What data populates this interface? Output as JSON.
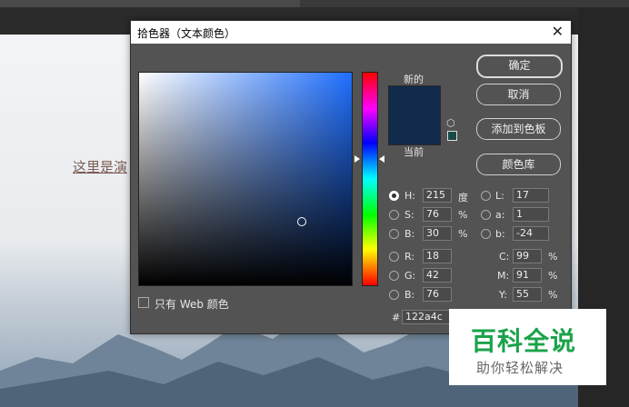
{
  "document": {
    "text": "这里是演"
  },
  "dialog": {
    "title": "拾色器（文本颜色）",
    "close_glyph": "✕",
    "new_label": "新的",
    "current_label": "当前",
    "current_color": "#122a4c",
    "buttons": {
      "ok": "确定",
      "cancel": "取消",
      "add_to_swatches": "添加到色板",
      "color_libraries": "颜色库"
    },
    "only_web_colors": "只有 Web 颜色",
    "hsb": [
      {
        "label": "H:",
        "value": "215",
        "unit": "度",
        "selected": true
      },
      {
        "label": "S:",
        "value": "76",
        "unit": "%",
        "selected": false
      },
      {
        "label": "B:",
        "value": "30",
        "unit": "%",
        "selected": false
      }
    ],
    "rgb": [
      {
        "label": "R:",
        "value": "18"
      },
      {
        "label": "G:",
        "value": "42"
      },
      {
        "label": "B:",
        "value": "76"
      }
    ],
    "lab": [
      {
        "label": "L:",
        "value": "17"
      },
      {
        "label": "a:",
        "value": "1"
      },
      {
        "label": "b:",
        "value": "-24"
      }
    ],
    "cmyk": [
      {
        "label": "C:",
        "value": "99",
        "unit": "%"
      },
      {
        "label": "M:",
        "value": "91",
        "unit": "%"
      },
      {
        "label": "Y:",
        "value": "55",
        "unit": "%"
      }
    ],
    "hex_label": "#",
    "hex_value": "122a4c"
  },
  "watermark": {
    "title": "百科全说",
    "subtitle": "助你轻松解决"
  }
}
